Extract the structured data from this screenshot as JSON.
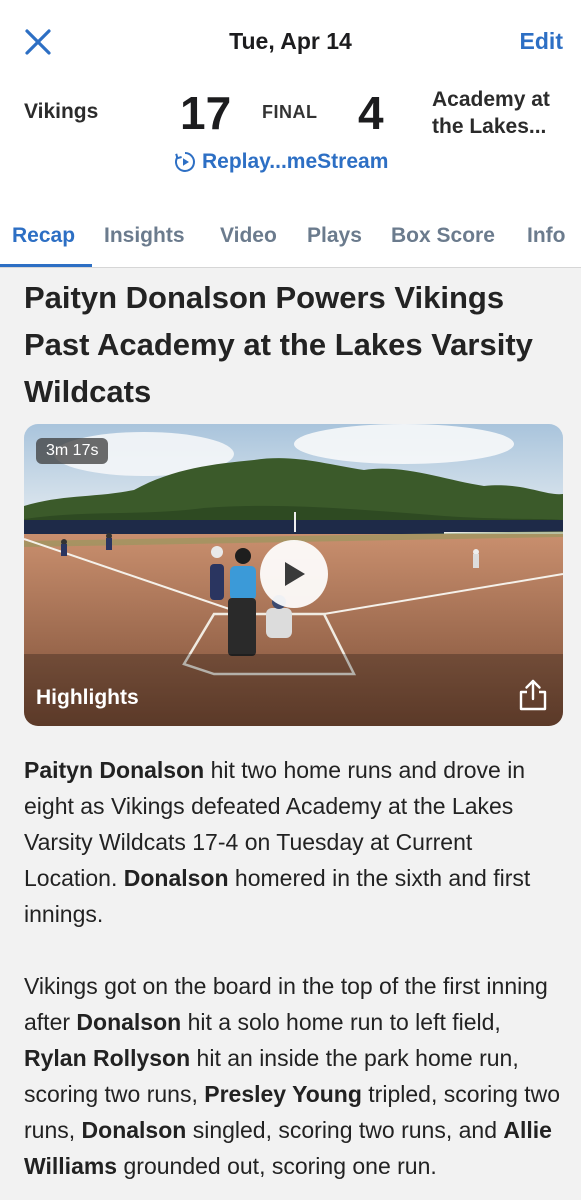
{
  "header": {
    "date": "Tue, Apr 14",
    "edit_label": "Edit"
  },
  "score": {
    "home_team": "Vikings",
    "home_score": "17",
    "status": "FINAL",
    "away_score": "4",
    "away_team_line1": "Academy at",
    "away_team_line2": "the Lakes..."
  },
  "replay": {
    "label": "Replay...meStream"
  },
  "tabs": [
    {
      "label": "Recap"
    },
    {
      "label": "Insights"
    },
    {
      "label": "Video"
    },
    {
      "label": "Plays"
    },
    {
      "label": "Box Score"
    },
    {
      "label": "Info"
    }
  ],
  "article": {
    "headline": "Paityn Donalson Powers Vikings Past Academy at the Lakes Varsity Wildcats",
    "video": {
      "duration": "3m 17s",
      "label": "Highlights"
    },
    "p1": {
      "s1_bold": "Paityn Donalson",
      "s2": " hit two home runs and drove in eight as Vikings defeated Academy at the Lakes Varsity Wildcats 17-4 on Tuesday at Current Location. ",
      "s3_bold": "Donalson",
      "s4": " homered in the sixth and first innings."
    },
    "p2": {
      "s1": "Vikings got on the board in the top of the first inning after ",
      "s2_bold": "Donalson",
      "s3": " hit a solo home run to left field, ",
      "s4_bold": "Rylan Rollyson",
      "s5": " hit an inside the park home run, scoring two runs, ",
      "s6_bold": "Presley Young",
      "s7": " tripled, scoring two runs, ",
      "s8_bold": "Donalson",
      "s9": " singled, scoring two runs, and ",
      "s10_bold": "Allie Williams",
      "s11": " grounded out, scoring one run."
    }
  },
  "colors": {
    "accent": "#2d6fc4",
    "tab_inactive": "#6b7b8d",
    "background": "#f2f2f2"
  },
  "icons": [
    "close-icon",
    "replay-play-icon",
    "play-icon",
    "share-icon"
  ]
}
